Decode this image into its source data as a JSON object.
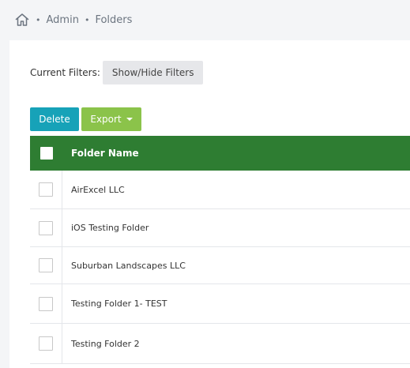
{
  "breadcrumb": {
    "home_icon": "home-icon",
    "items": [
      "Admin",
      "Folders"
    ]
  },
  "filters": {
    "label": "Current Filters:",
    "toggle_label": "Show/Hide Filters"
  },
  "actions": {
    "delete_label": "Delete",
    "export_label": "Export"
  },
  "table": {
    "header": {
      "name": "Folder Name"
    },
    "rows": [
      "AirExcel LLC",
      "iOS Testing Folder",
      "Suburban Landscapes LLC",
      "Testing Folder 1- TEST",
      "Testing Folder 2"
    ]
  },
  "colors": {
    "header_green": "#2e7d32",
    "delete_teal": "#17a2b8",
    "export_green": "#8bc34a"
  }
}
